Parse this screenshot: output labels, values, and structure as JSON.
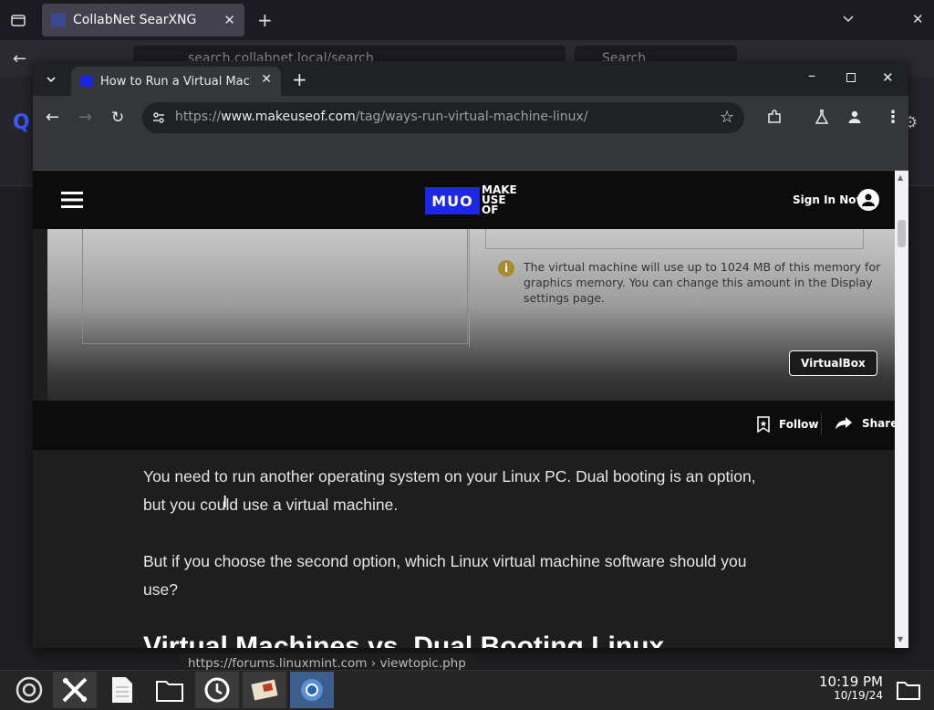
{
  "firefox": {
    "tab_title": "CollabNet SearXNG",
    "url_text": "search.collabnet.local/search",
    "search_placeholder": "Search"
  },
  "chrome": {
    "tab_title": "How to Run a Virtual Machine",
    "url_prefix": "https://",
    "url_host": "www.makeuseof.com",
    "url_path": "/tag/ways-run-virtual-machine-linux/"
  },
  "site": {
    "logo_box": "MUO",
    "logo_text": [
      "MAKE",
      "USE",
      "OF"
    ],
    "sign_in": "Sign In Now"
  },
  "hero": {
    "note": "The virtual machine will use up to 1024 MB of this memory for graphics memory. You can change this amount in the Display settings page.",
    "tag_button": "VirtualBox"
  },
  "actions": {
    "follow": "Follow",
    "share": "Share"
  },
  "article": {
    "para1": "You need to run another operating system on your Linux PC. Dual booting is an option, but you could use a virtual machine.",
    "para2": "But if you choose the second option, which Linux virtual machine software should you use?",
    "heading": "Virtual Machines vs. Dual Booting Linux"
  },
  "status_url": "https://forums.linuxmint.com  › viewtopic.php",
  "taskbar": {
    "time": "10:19 PM",
    "date": "10/19/24"
  },
  "colors": {
    "muo_blue": "#1d27e6",
    "chrome_dark": "#202124"
  }
}
